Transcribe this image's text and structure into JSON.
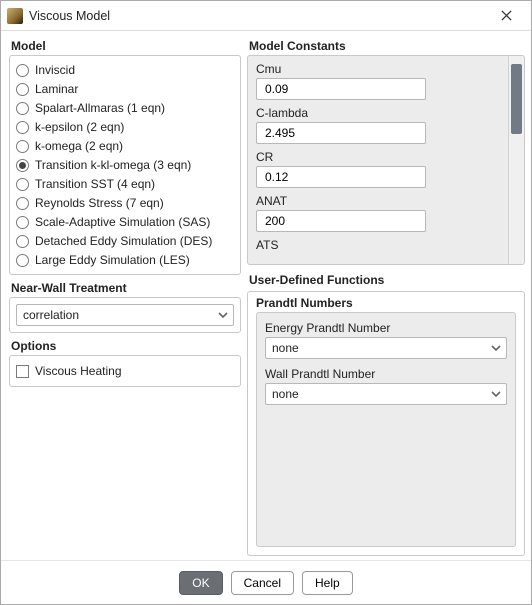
{
  "window": {
    "title": "Viscous Model"
  },
  "sections": {
    "model": "Model",
    "constants": "Model Constants",
    "near_wall": "Near-Wall Treatment",
    "options": "Options",
    "udf": "User-Defined Functions",
    "prandtl": "Prandtl Numbers"
  },
  "model_options": [
    {
      "label": "Inviscid",
      "checked": false
    },
    {
      "label": "Laminar",
      "checked": false
    },
    {
      "label": "Spalart-Allmaras (1 eqn)",
      "checked": false
    },
    {
      "label": "k-epsilon (2 eqn)",
      "checked": false
    },
    {
      "label": "k-omega (2 eqn)",
      "checked": false
    },
    {
      "label": "Transition k-kl-omega (3 eqn)",
      "checked": true
    },
    {
      "label": "Transition SST (4 eqn)",
      "checked": false
    },
    {
      "label": "Reynolds Stress (7 eqn)",
      "checked": false
    },
    {
      "label": "Scale-Adaptive Simulation (SAS)",
      "checked": false
    },
    {
      "label": "Detached Eddy Simulation (DES)",
      "checked": false
    },
    {
      "label": "Large Eddy Simulation (LES)",
      "checked": false
    }
  ],
  "near_wall": {
    "value": "correlation"
  },
  "viscous_heating": {
    "label": "Viscous Heating",
    "checked": false
  },
  "constants": [
    {
      "label": "Cmu",
      "value": "0.09"
    },
    {
      "label": "C-lambda",
      "value": "2.495"
    },
    {
      "label": "CR",
      "value": "0.12"
    },
    {
      "label": "ANAT",
      "value": "200"
    },
    {
      "label": "ATS",
      "value": ""
    }
  ],
  "udf": {
    "energy_label": "Energy Prandtl Number",
    "energy_value": "none",
    "wall_label": "Wall Prandtl Number",
    "wall_value": "none"
  },
  "buttons": {
    "ok": "OK",
    "cancel": "Cancel",
    "help": "Help"
  }
}
